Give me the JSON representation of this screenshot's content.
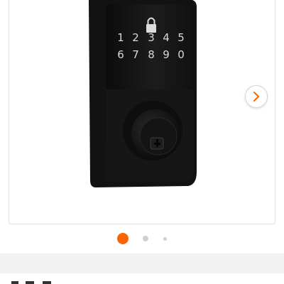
{
  "product": {
    "name": "Electronic keypad deadbolt",
    "keypad_lock_icon": "lock-icon",
    "keypad_keys": [
      "1",
      "2",
      "3",
      "4",
      "5",
      "6",
      "7",
      "8",
      "9",
      "0"
    ]
  },
  "carousel": {
    "next_icon": "chevron-right-icon",
    "slide_count": 3,
    "active_index": 0
  },
  "colors": {
    "accent": "#f96302",
    "lock_finish": "#151515",
    "dot_inactive": "#cfcfcf",
    "band": "#f2f2f2"
  }
}
